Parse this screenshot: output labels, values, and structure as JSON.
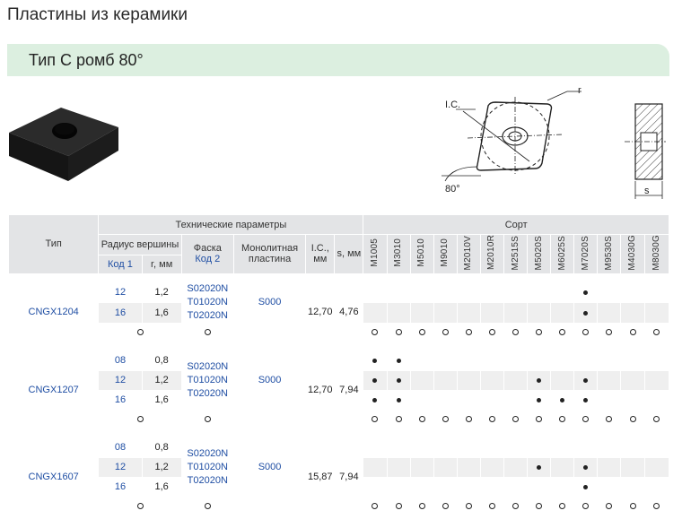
{
  "page_title": "Пластины из керамики",
  "banner_title": "Тип С ромб 80°",
  "diagram": {
    "ic_label": "I.C.",
    "r_label": "r",
    "angle_label": "80°",
    "s_label": "s"
  },
  "table": {
    "type_header": "Тип",
    "tech_header": "Технические параметры",
    "grade_header": "Сорт",
    "radius_header": "Радиус вершины",
    "code1": "Код 1",
    "r_mm": "r, мм",
    "chamfer_header": "Фаска",
    "code2": "Код 2",
    "mono_header": "Монолитная пластина",
    "ic_header": "I.C., мм",
    "s_header": "s, мм",
    "grades": [
      "M1005",
      "M3010",
      "M5010",
      "M9010",
      "M2010V",
      "M2010R",
      "M2515S",
      "M5020S",
      "M6025S",
      "M7020S",
      "M9530S",
      "M4030G",
      "M8030G"
    ],
    "groups": [
      {
        "type": "CNGX1204",
        "rows": [
          {
            "code": "12",
            "r": "1,2",
            "dots": [
              0,
              0,
              0,
              0,
              0,
              0,
              0,
              0,
              0,
              1,
              0,
              0,
              0
            ]
          },
          {
            "code": "16",
            "r": "1,6",
            "dots": [
              0,
              0,
              0,
              0,
              0,
              0,
              0,
              0,
              0,
              1,
              0,
              0,
              0
            ]
          }
        ],
        "chamfers": [
          "S02020N",
          "T01020N",
          "T02020N"
        ],
        "mono": "S000",
        "ic": "12,70",
        "s": "4,76",
        "footer_dots": [
          1,
          1,
          1,
          1,
          1,
          1,
          1,
          1,
          1,
          1,
          1,
          1,
          1
        ]
      },
      {
        "type": "CNGX1207",
        "rows": [
          {
            "code": "08",
            "r": "0,8",
            "dots": [
              1,
              1,
              0,
              0,
              0,
              0,
              0,
              0,
              0,
              0,
              0,
              0,
              0
            ]
          },
          {
            "code": "12",
            "r": "1,2",
            "dots": [
              1,
              1,
              0,
              0,
              0,
              0,
              0,
              1,
              0,
              1,
              0,
              0,
              0
            ]
          },
          {
            "code": "16",
            "r": "1,6",
            "dots": [
              1,
              1,
              0,
              0,
              0,
              0,
              0,
              1,
              1,
              1,
              0,
              0,
              0
            ]
          }
        ],
        "chamfers": [
          "S02020N",
          "T01020N",
          "T02020N"
        ],
        "mono": "S000",
        "ic": "12,70",
        "s": "7,94",
        "footer_dots": [
          1,
          1,
          1,
          1,
          1,
          1,
          1,
          1,
          1,
          1,
          1,
          1,
          1
        ]
      },
      {
        "type": "CNGX1607",
        "rows": [
          {
            "code": "08",
            "r": "0,8",
            "dots": [
              0,
              0,
              0,
              0,
              0,
              0,
              0,
              0,
              0,
              0,
              0,
              0,
              0
            ]
          },
          {
            "code": "12",
            "r": "1,2",
            "dots": [
              0,
              0,
              0,
              0,
              0,
              0,
              0,
              1,
              0,
              1,
              0,
              0,
              0
            ]
          },
          {
            "code": "16",
            "r": "1,6",
            "dots": [
              0,
              0,
              0,
              0,
              0,
              0,
              0,
              0,
              0,
              1,
              0,
              0,
              0
            ]
          }
        ],
        "chamfers": [
          "S02020N",
          "T01020N",
          "T02020N"
        ],
        "mono": "S000",
        "ic": "15,87",
        "s": "7,94",
        "footer_dots": [
          1,
          1,
          1,
          1,
          1,
          1,
          1,
          1,
          1,
          1,
          1,
          1,
          1
        ]
      }
    ]
  },
  "colors": {
    "banner": "#dcefe0",
    "header": "#e3e4e6",
    "code_blue": "#1f4ea3",
    "shade": "#efefef"
  }
}
